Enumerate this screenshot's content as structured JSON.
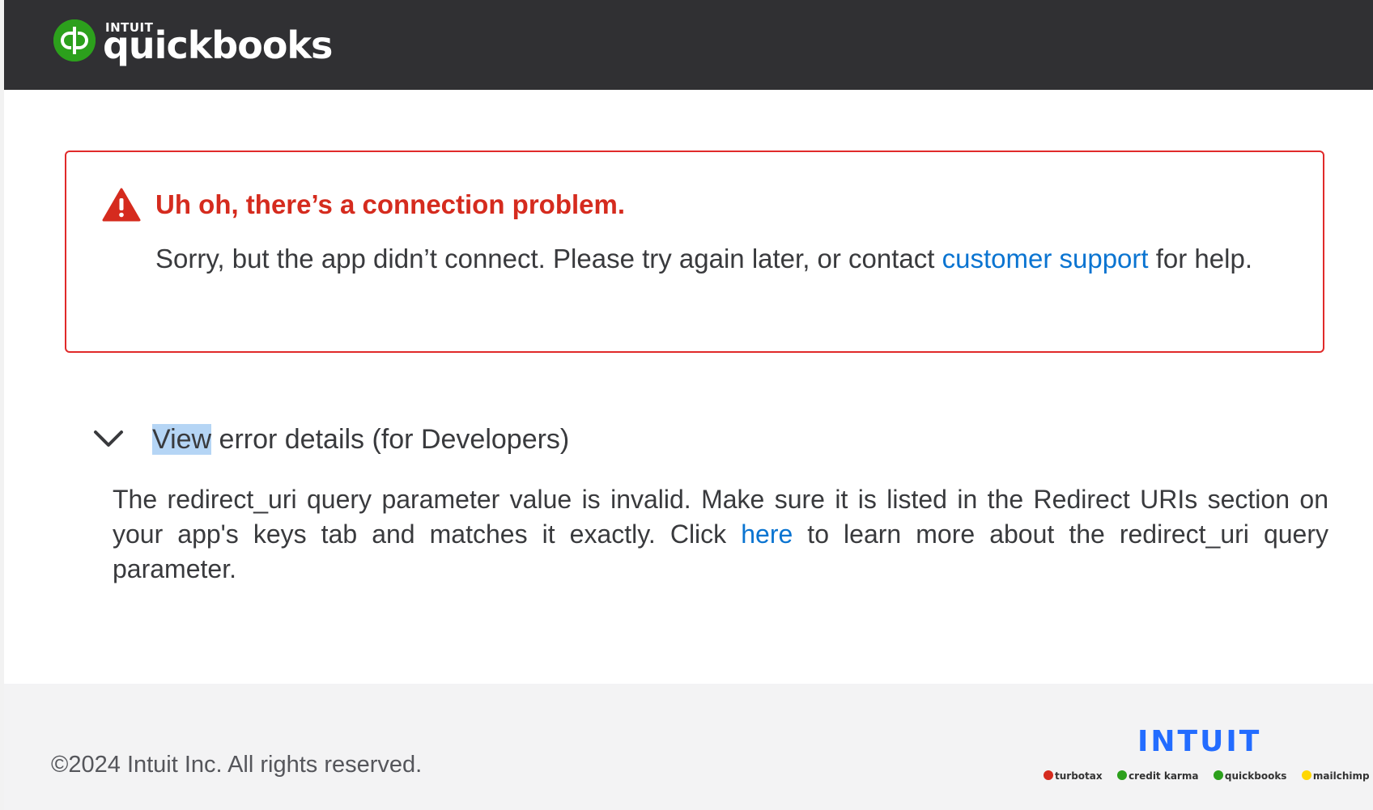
{
  "header": {
    "brand_top": "INTUIT",
    "brand_name": "quickbooks",
    "logo_color": "#2ca01c",
    "background": "#303033"
  },
  "error": {
    "icon": "warning-triangle-icon",
    "title": "Uh oh, there’s a connection problem.",
    "message_before": "Sorry, but the app didn’t connect. Please try again later, or contact ",
    "support_link": "customer support",
    "message_after": " for help.",
    "accent_color": "#d52b1e"
  },
  "details": {
    "toggle_icon": "chevron-down-icon",
    "toggle_highlighted": "View",
    "toggle_rest": " error details (for Developers)",
    "text_before": "The redirect_uri query parameter value is invalid. Make sure it is listed in the Redirect URIs section on your app's keys tab and matches it exactly. Click ",
    "link": "here",
    "text_after": " to learn more about the redirect_uri query parameter."
  },
  "footer": {
    "copyright": "©2024 Intuit Inc. All rights reserved.",
    "company_logo": "INTUIT",
    "brands": [
      {
        "label": "turbotax",
        "color": "#d52b1e"
      },
      {
        "label": "credit karma",
        "color": "#2ca01c"
      },
      {
        "label": "quickbooks",
        "color": "#2ca01c"
      },
      {
        "label": "mailchimp",
        "color": "#ffd700"
      }
    ]
  }
}
